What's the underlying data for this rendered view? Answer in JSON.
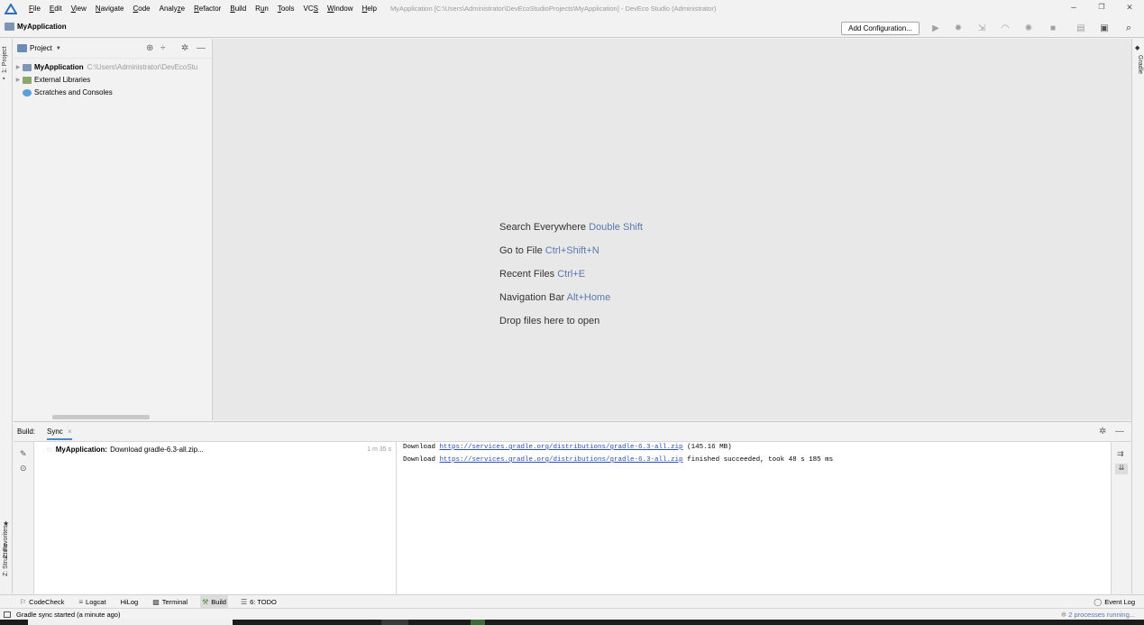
{
  "menubar": {
    "items": [
      {
        "prefix": "",
        "u": "F",
        "rest": "ile"
      },
      {
        "prefix": "",
        "u": "E",
        "rest": "dit"
      },
      {
        "prefix": "",
        "u": "V",
        "rest": "iew"
      },
      {
        "prefix": "",
        "u": "N",
        "rest": "avigate"
      },
      {
        "prefix": "",
        "u": "C",
        "rest": "ode"
      },
      {
        "prefix": "Analy",
        "u": "z",
        "rest": "e"
      },
      {
        "prefix": "",
        "u": "R",
        "rest": "efactor"
      },
      {
        "prefix": "",
        "u": "B",
        "rest": "uild"
      },
      {
        "prefix": "R",
        "u": "u",
        "rest": "n"
      },
      {
        "prefix": "",
        "u": "T",
        "rest": "ools"
      },
      {
        "prefix": "VC",
        "u": "S",
        "rest": ""
      },
      {
        "prefix": "",
        "u": "W",
        "rest": "indow"
      },
      {
        "prefix": "",
        "u": "H",
        "rest": "elp"
      }
    ],
    "window_title": "MyApplication [C:\\Users\\Administrator\\DevEcoStudioProjects\\MyApplication] - DevEco Studio (Administrator)",
    "win_minimize": "–",
    "win_restore": "❐",
    "win_close": "✕"
  },
  "navbar": {
    "project_name": "MyApplication",
    "add_configuration": "Add Configuration..."
  },
  "left_strip": {
    "project_tab": "1: Project",
    "favorites_tab": "2: Favorites",
    "structure_tab": "Z: Structure"
  },
  "right_strip": {
    "gradle_tab": "Gradle"
  },
  "project_panel": {
    "header_label": "Project",
    "tree": [
      {
        "label": "MyApplication",
        "path": "C:\\Users\\Administrator\\DevEcoStu"
      },
      {
        "label": "External Libraries",
        "path": ""
      },
      {
        "label": "Scratches and Consoles",
        "path": ""
      }
    ]
  },
  "editor_hints": [
    {
      "text": "Search Everywhere",
      "key": "Double Shift"
    },
    {
      "text": "Go to File",
      "key": "Ctrl+Shift+N"
    },
    {
      "text": "Recent Files",
      "key": "Ctrl+E"
    },
    {
      "text": "Navigation Bar",
      "key": "Alt+Home"
    },
    {
      "text": "Drop files here to open",
      "key": ""
    }
  ],
  "build_panel": {
    "title": "Build:",
    "tab": "Sync",
    "tab_close": "×",
    "tree_row": {
      "name": "MyApplication:",
      "text": "Download gradle-6.3-all.zip...",
      "time": "1 m 35 s"
    },
    "output": [
      {
        "prefix": "Download ",
        "link": "https://services.gradle.org/distributions/gradle-6.3-all.zip",
        "suffix": " (145.16 MB)"
      },
      {
        "prefix": "Download ",
        "link": "https://services.gradle.org/distributions/gradle-6.3-all.zip",
        "suffix": " finished succeeded, took 48 s 185 ms"
      }
    ]
  },
  "bottom_tools": {
    "codecheck": "CodeCheck",
    "logcat": "Logcat",
    "hilog": "HiLog",
    "terminal": "Terminal",
    "build": "Build",
    "todo": "6: TODO",
    "event_log": "Event Log"
  },
  "status": {
    "message": "Gradle sync started (a minute ago)",
    "processes": "2 processes running..."
  },
  "colors": {
    "accent": "#4a88c7",
    "link": "#2a4eb8",
    "hint_key": "#5b78b0"
  }
}
